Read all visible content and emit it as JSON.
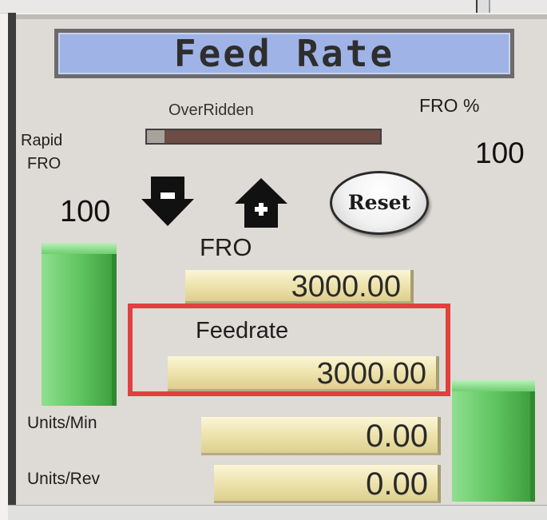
{
  "panel": {
    "title": "Feed Rate",
    "overridden_label": "OverRidden",
    "fro_percent_label": "FRO %",
    "fro_percent_value": "100",
    "rapid_fro_label_line1": "Rapid",
    "rapid_fro_label_line2": "FRO",
    "rapid_fro_value": "100",
    "fro_label": "FRO",
    "fro_readout": "3000.00",
    "feedrate_label": "Feedrate",
    "feedrate_readout": "3000.00",
    "units_min_label": "Units/Min",
    "units_min_readout": "0.00",
    "units_rev_label": "Units/Rev",
    "units_rev_readout": "0.00",
    "reset_label": "Reset"
  },
  "icons": {
    "fro_down": "arrow-down-minus-icon",
    "fro_up": "arrow-up-plus-icon"
  },
  "colors": {
    "title_background": "#9fb3e6",
    "readout_background": "#ece1aa",
    "slider_green": "#5cc25c",
    "overridden_indicator": "#6c4c45",
    "highlight": "#e0403e"
  }
}
